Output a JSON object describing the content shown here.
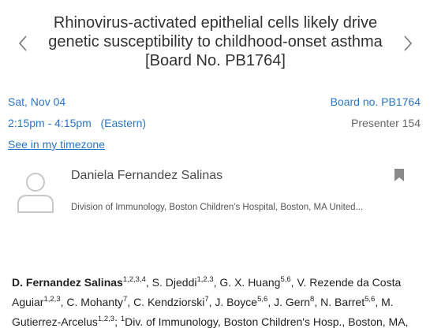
{
  "header": {
    "title": "Rhinovirus-activated epithelial cells likely drive genetic susceptibility to childhood-onset asthma [Board No. PB1764]",
    "prev_icon": "chevron-left-icon",
    "next_icon": "chevron-right-icon"
  },
  "session": {
    "date": "Sat, Nov 04",
    "time": "2:15pm - 4:15pm",
    "timezone": "(Eastern)",
    "timezone_link": "See in my timezone",
    "board": "Board no. PB1764",
    "presenter": "Presenter 154"
  },
  "presenter_card": {
    "name": "Daniela Fernandez Salinas",
    "affiliation": "Division of Immunology, Boston Children's Hospital, Boston, MA United...",
    "avatar_icon": "user-avatar-icon",
    "bookmark_icon": "bookmark-icon"
  },
  "authors": {
    "a1": "D. Fernandez Salinas",
    "a1_sup": "1,2,3,4",
    "a2": "S. Djeddi",
    "a2_sup": "1,2,3",
    "a3": "G. X. Huang",
    "a3_sup": "5,6",
    "a4": "V. Rezende da Costa Aguiar",
    "a4_sup": "1,2,3",
    "a5": "C. Mohanty",
    "a5_sup": "7",
    "a6": "C. Kendziorski",
    "a6_sup": "7",
    "a7": "J. Boyce",
    "a7_sup": "5,6",
    "a8": "J. Gern",
    "a8_sup": "8",
    "a9": "N. Barret",
    "a9_sup": "5,6",
    "a10": "M. Gutierrez-Arcelus",
    "a10_sup": "1,2,3",
    "affil_sup": "1",
    "affil_text": "Div. of Immunology, Boston Children's Hosp., Boston, MA,"
  },
  "colors": {
    "link": "#2a76c6",
    "text": "#333333",
    "icon": "#bfbfbf"
  }
}
